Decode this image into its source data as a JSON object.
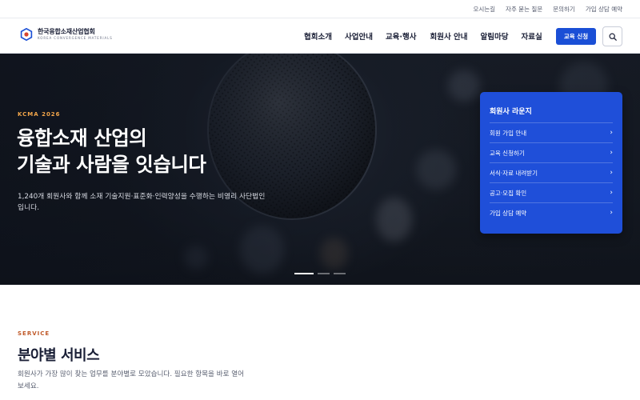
{
  "util_bar": {
    "links": [
      "오시는길",
      "자주 묻는 질문",
      "문의하기",
      "가입 상담 예약"
    ]
  },
  "header": {
    "logo_name": "한국융합소재산업협회",
    "logo_sub": "KOREA CONVERGENCE MATERIALS",
    "nav": [
      "협회소개",
      "사업안내",
      "교육·행사",
      "회원사 안내",
      "알림마당",
      "자료실"
    ],
    "cta_label": "교육 신청",
    "search_icon": "search-icon"
  },
  "hero": {
    "eyebrow": "KCMA 2026",
    "title_line1": "융합소재 산업의",
    "title_line2": "기술과 사람을 잇습니다",
    "description": "1,240개 회원사와 함께 소재 기술지원·표준화·인력양성을 수행하는 비영리 사단법인입니다.",
    "slides": 3,
    "active_slide": 1
  },
  "lounge": {
    "title": "회원사 라운지",
    "items": [
      "회원 가입 안내",
      "교육 신청하기",
      "서식·자료 내려받기",
      "공고·모집 확인",
      "가입 상담 예약"
    ]
  },
  "service": {
    "eyebrow": "SERVICE",
    "title": "분야별 서비스",
    "description": "회원사가 가장 많이 찾는 업무를 분야별로 모았습니다. 필요한 항목을 바로 열어 보세요."
  },
  "colors": {
    "brand_blue": "#1a4fd6",
    "lounge_blue": "#1f4fd9",
    "hero_accent": "#f2a54a",
    "service_accent": "#c05a2a"
  }
}
